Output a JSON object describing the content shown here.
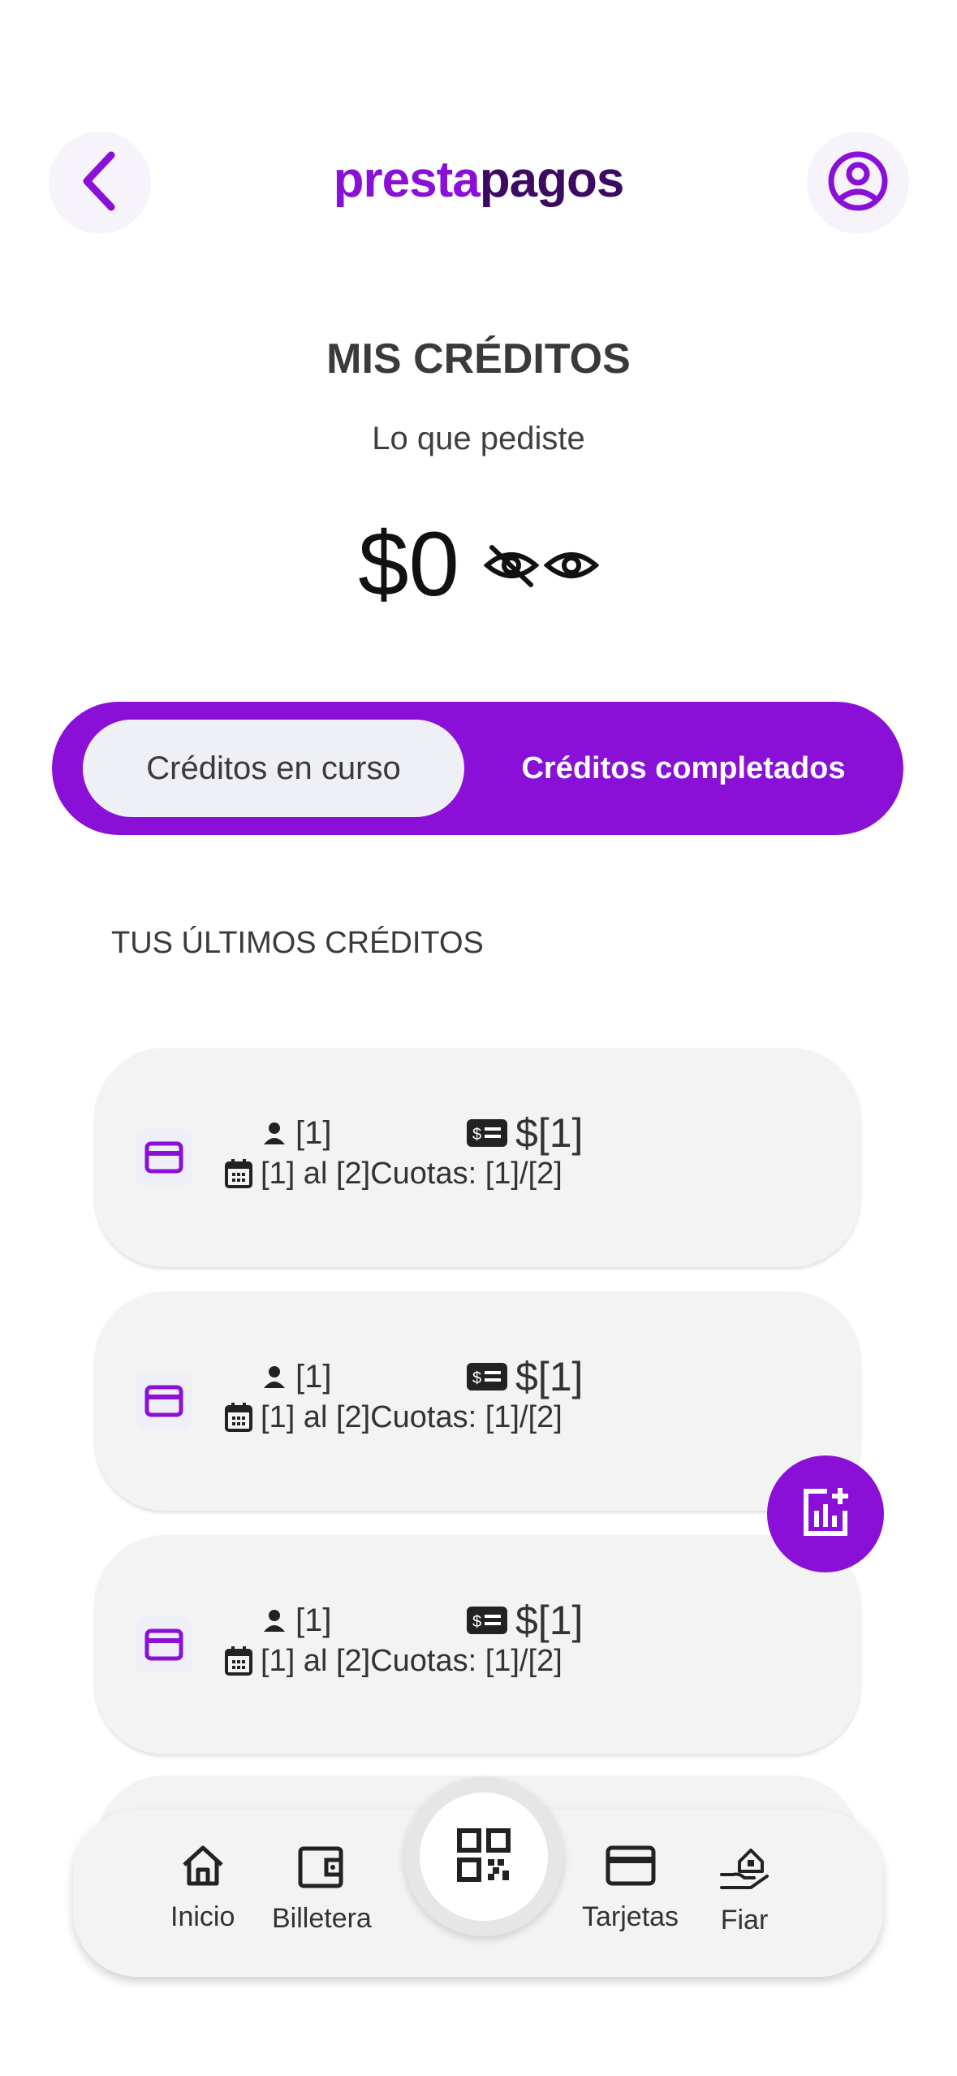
{
  "header": {
    "logo_left": "presta",
    "logo_right": "pagos",
    "back_icon": "chevron-left-icon",
    "profile_icon": "user-circle-icon",
    "accent_color": "#8a10d8"
  },
  "summary": {
    "title": "MIS CRÉDITOS",
    "subtitle": "Lo que pediste",
    "amount": "$0"
  },
  "tabs": {
    "active": "Créditos en curso",
    "inactive": "Créditos completados"
  },
  "section_title": "TUS ÚLTIMOS CRÉDITOS",
  "credits": [
    {
      "user": "[1]",
      "amount": "$[1]",
      "dates": "[1] al [2]",
      "installments": "Cuotas: [1]/[2]"
    },
    {
      "user": "[1]",
      "amount": "$[1]",
      "dates": "[1] al [2]",
      "installments": "Cuotas: [1]/[2]"
    },
    {
      "user": "[1]",
      "amount": "$[1]",
      "dates": "[1] al [2]",
      "installments": "Cuotas: [1]/[2]"
    }
  ],
  "nav": {
    "home": "Inicio",
    "wallet": "Billetera",
    "cards": "Tarjetas",
    "trust": "Fiar",
    "center_icon": "qr-code-icon"
  }
}
